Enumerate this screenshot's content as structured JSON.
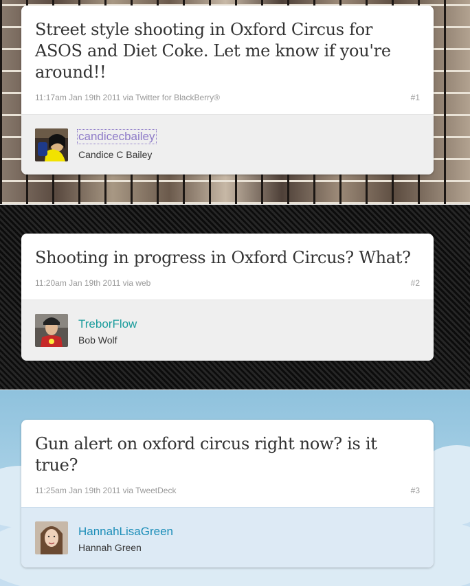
{
  "tweets": [
    {
      "text": "Street style shooting in Oxford Circus for ASOS and Diet Coke. Let me know if you're around!!",
      "time": "11:17am Jan 19th 2011",
      "via": "via Twitter for BlackBerry®",
      "number": "#1",
      "username": "candicecbailey",
      "fullname": "Candice C Bailey",
      "background": "photo-collage"
    },
    {
      "text": "Shooting in progress in Oxford Circus? What?",
      "time": "11:20am Jan 19th 2011",
      "via": "via web",
      "number": "#2",
      "username": "TreborFlow",
      "fullname": "Bob Wolf",
      "background": "carbon-fiber"
    },
    {
      "text": "Gun alert on oxford circus right now? is it true?",
      "time": "11:25am Jan 19th 2011",
      "via": "via TweetDeck",
      "number": "#3",
      "username": "HannahLisaGreen",
      "fullname": "Hannah Green",
      "background": "sky-clouds"
    }
  ],
  "colors": {
    "username_1": "#8e7bc8",
    "username_2": "#1a9c9c",
    "username_3": "#1a8db8",
    "meta_text": "#999999",
    "tweet_text": "#333333"
  }
}
